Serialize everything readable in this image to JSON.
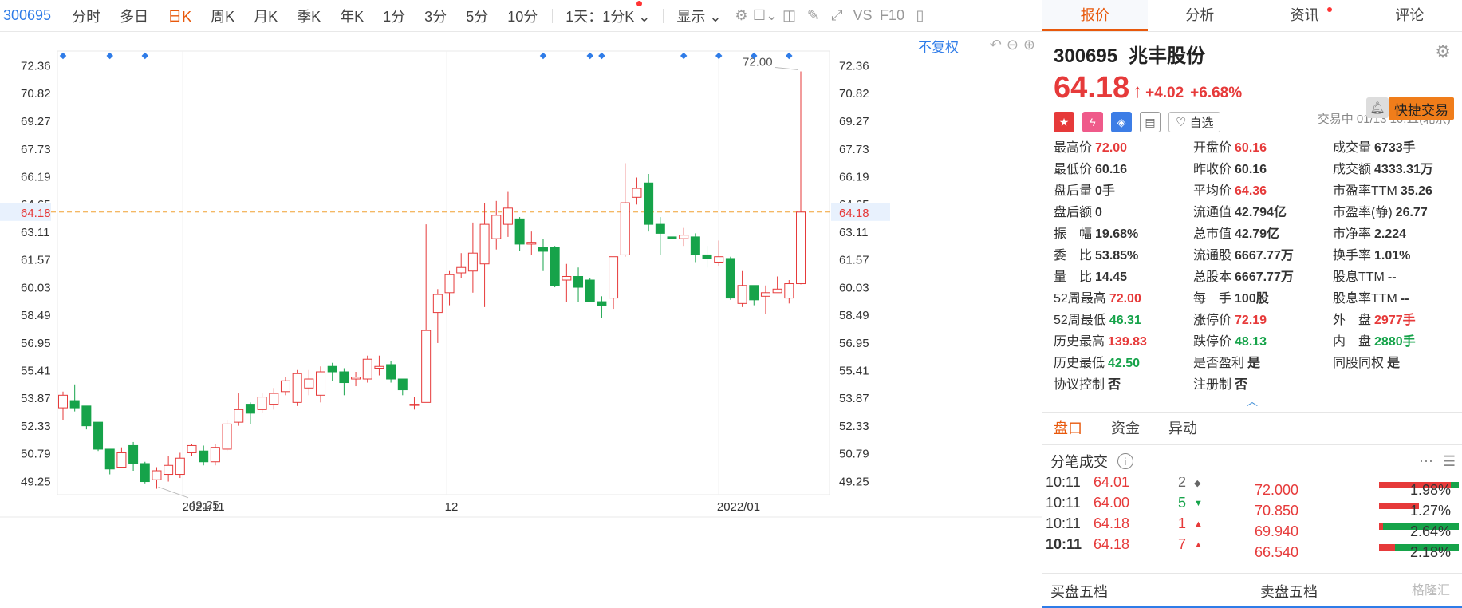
{
  "toolbar": {
    "code": "300695",
    "periods": [
      "分时",
      "多日",
      "日K",
      "周K",
      "月K",
      "季K",
      "年K",
      "1分",
      "3分",
      "5分",
      "10分"
    ],
    "active_period": "日K",
    "multi": "1天：1分K",
    "display": "显示",
    "vs": "VS",
    "f10": "F10"
  },
  "chart": {
    "fq_label": "不复权",
    "y_ticks": [
      "72.36",
      "70.82",
      "69.27",
      "67.73",
      "66.19",
      "64.65",
      "63.11",
      "61.57",
      "60.03",
      "58.49",
      "56.95",
      "55.41",
      "53.87",
      "52.33",
      "50.79",
      "49.25"
    ],
    "current_price_label": "64.18",
    "x_labels": [
      "2021/11",
      "12",
      "2022/01"
    ],
    "high_label": "72.00",
    "low_label": "49.25"
  },
  "chart_data": {
    "type": "candlestick",
    "y_range": [
      48.47,
      73.13
    ],
    "current_price": 64.18,
    "candles": [
      {
        "o": 53.3,
        "c": 54.0,
        "h": 54.2,
        "l": 52.6
      },
      {
        "o": 53.7,
        "c": 53.3,
        "h": 54.6,
        "l": 53.1
      },
      {
        "o": 53.4,
        "c": 52.3,
        "h": 53.4,
        "l": 52.1
      },
      {
        "o": 52.5,
        "c": 51.0,
        "h": 52.5,
        "l": 50.9
      },
      {
        "o": 51.0,
        "c": 49.9,
        "h": 51.0,
        "l": 49.6
      },
      {
        "o": 50.0,
        "c": 50.8,
        "h": 51.1,
        "l": 50.0
      },
      {
        "o": 51.2,
        "c": 50.2,
        "h": 51.4,
        "l": 49.8
      },
      {
        "o": 50.2,
        "c": 49.2,
        "h": 50.3,
        "l": 49.1
      },
      {
        "o": 49.3,
        "c": 49.8,
        "h": 50.0,
        "l": 48.8
      },
      {
        "o": 49.6,
        "c": 50.1,
        "h": 50.6,
        "l": 49.2
      },
      {
        "o": 49.6,
        "c": 50.5,
        "h": 50.8,
        "l": 49.4
      },
      {
        "o": 50.8,
        "c": 51.2,
        "h": 51.3,
        "l": 50.6
      },
      {
        "o": 50.9,
        "c": 50.3,
        "h": 51.2,
        "l": 50.1
      },
      {
        "o": 50.3,
        "c": 51.1,
        "h": 51.3,
        "l": 50.1
      },
      {
        "o": 51.0,
        "c": 52.4,
        "h": 52.6,
        "l": 50.9
      },
      {
        "o": 52.5,
        "c": 53.2,
        "h": 54.1,
        "l": 52.3
      },
      {
        "o": 53.5,
        "c": 53.0,
        "h": 53.6,
        "l": 52.4
      },
      {
        "o": 53.2,
        "c": 53.9,
        "h": 54.1,
        "l": 53.0
      },
      {
        "o": 53.5,
        "c": 54.1,
        "h": 54.4,
        "l": 53.2
      },
      {
        "o": 54.2,
        "c": 54.8,
        "h": 55.0,
        "l": 54.0
      },
      {
        "o": 53.6,
        "c": 55.2,
        "h": 55.4,
        "l": 53.4
      },
      {
        "o": 54.4,
        "c": 54.9,
        "h": 55.4,
        "l": 54.0
      },
      {
        "o": 54.0,
        "c": 55.3,
        "h": 55.6,
        "l": 53.6
      },
      {
        "o": 55.6,
        "c": 55.3,
        "h": 55.8,
        "l": 54.8
      },
      {
        "o": 55.3,
        "c": 54.7,
        "h": 55.5,
        "l": 54.0
      },
      {
        "o": 54.9,
        "c": 55.0,
        "h": 55.3,
        "l": 54.5
      },
      {
        "o": 54.9,
        "c": 56.0,
        "h": 56.2,
        "l": 54.7
      },
      {
        "o": 55.5,
        "c": 55.6,
        "h": 56.2,
        "l": 55.1
      },
      {
        "o": 55.7,
        "c": 54.9,
        "h": 55.9,
        "l": 54.7
      },
      {
        "o": 54.9,
        "c": 54.3,
        "h": 54.9,
        "l": 54.0
      },
      {
        "o": 53.5,
        "c": 53.5,
        "h": 53.9,
        "l": 53.2
      },
      {
        "o": 53.6,
        "c": 57.6,
        "h": 63.5,
        "l": 53.6
      },
      {
        "o": 58.6,
        "c": 59.6,
        "h": 59.9,
        "l": 56.9
      },
      {
        "o": 59.7,
        "c": 60.7,
        "h": 60.9,
        "l": 59.0
      },
      {
        "o": 60.8,
        "c": 61.1,
        "h": 61.9,
        "l": 60.5
      },
      {
        "o": 60.9,
        "c": 61.9,
        "h": 63.6,
        "l": 59.7
      },
      {
        "o": 61.3,
        "c": 63.5,
        "h": 64.7,
        "l": 58.9
      },
      {
        "o": 62.7,
        "c": 64.0,
        "h": 64.8,
        "l": 62.1
      },
      {
        "o": 63.5,
        "c": 64.4,
        "h": 65.3,
        "l": 62.8
      },
      {
        "o": 63.8,
        "c": 62.4,
        "h": 63.9,
        "l": 62.0
      },
      {
        "o": 62.4,
        "c": 62.5,
        "h": 63.1,
        "l": 61.8
      },
      {
        "o": 62.2,
        "c": 62.0,
        "h": 62.7,
        "l": 60.9
      },
      {
        "o": 62.2,
        "c": 60.1,
        "h": 62.3,
        "l": 60.0
      },
      {
        "o": 60.4,
        "c": 60.6,
        "h": 61.3,
        "l": 59.2
      },
      {
        "o": 60.6,
        "c": 60.0,
        "h": 61.1,
        "l": 59.2
      },
      {
        "o": 60.4,
        "c": 59.2,
        "h": 60.5,
        "l": 59.2
      },
      {
        "o": 59.2,
        "c": 59.0,
        "h": 59.5,
        "l": 58.3
      },
      {
        "o": 59.4,
        "c": 61.7,
        "h": 61.7,
        "l": 58.8
      },
      {
        "o": 61.8,
        "c": 64.7,
        "h": 66.9,
        "l": 61.7
      },
      {
        "o": 65.0,
        "c": 65.5,
        "h": 66.1,
        "l": 64.6
      },
      {
        "o": 65.8,
        "c": 63.5,
        "h": 66.3,
        "l": 63.1
      },
      {
        "o": 63.5,
        "c": 63.0,
        "h": 63.9,
        "l": 61.8
      },
      {
        "o": 62.8,
        "c": 62.7,
        "h": 63.2,
        "l": 61.9
      },
      {
        "o": 62.7,
        "c": 62.9,
        "h": 63.3,
        "l": 62.3
      },
      {
        "o": 62.8,
        "c": 61.8,
        "h": 63.0,
        "l": 61.4
      },
      {
        "o": 61.8,
        "c": 61.6,
        "h": 62.3,
        "l": 61.1
      },
      {
        "o": 61.4,
        "c": 61.7,
        "h": 62.6,
        "l": 61.2
      },
      {
        "o": 61.6,
        "c": 59.4,
        "h": 61.7,
        "l": 59.3
      },
      {
        "o": 59.1,
        "c": 60.1,
        "h": 60.9,
        "l": 58.9
      },
      {
        "o": 60.1,
        "c": 59.3,
        "h": 60.1,
        "l": 59.0
      },
      {
        "o": 59.5,
        "c": 59.7,
        "h": 60.1,
        "l": 58.5
      },
      {
        "o": 59.7,
        "c": 59.9,
        "h": 60.6,
        "l": 59.7
      },
      {
        "o": 59.4,
        "c": 60.2,
        "h": 60.4,
        "l": 59.1
      },
      {
        "o": 60.2,
        "c": 64.18,
        "h": 72.0,
        "l": 60.16
      }
    ],
    "markers_count": 10
  },
  "panel": {
    "tabs": [
      "报价",
      "分析",
      "资讯",
      "评论"
    ],
    "active_tab": "报价",
    "code": "300695",
    "name": "兆丰股份",
    "price": "64.18",
    "change": "+4.02",
    "change_pct": "+6.68%",
    "status": "交易中 01/13 10:11(北京)",
    "watch_label": "自选",
    "quick_trade": "快捷交易",
    "quotes": [
      [
        {
          "k": "最高价",
          "v": "72.00",
          "c": "red"
        },
        {
          "k": "开盘价",
          "v": "60.16",
          "c": "red"
        },
        {
          "k": "成交量",
          "v": "6733手",
          "c": ""
        }
      ],
      [
        {
          "k": "最低价",
          "v": "60.16",
          "c": ""
        },
        {
          "k": "昨收价",
          "v": "60.16",
          "c": ""
        },
        {
          "k": "成交额",
          "v": "4333.31万",
          "c": ""
        }
      ],
      [
        {
          "k": "盘后量",
          "v": "0手",
          "c": ""
        },
        {
          "k": "平均价",
          "v": "64.36",
          "c": "red"
        },
        {
          "k": "市盈率TTM",
          "v": "35.26",
          "c": ""
        }
      ],
      [
        {
          "k": "盘后额",
          "v": "0",
          "c": ""
        },
        {
          "k": "流通值",
          "v": "42.794亿",
          "c": ""
        },
        {
          "k": "市盈率(静)",
          "v": "26.77",
          "c": ""
        }
      ],
      [
        {
          "k": "振　幅",
          "v": "19.68%",
          "c": ""
        },
        {
          "k": "总市值",
          "v": "42.79亿",
          "c": ""
        },
        {
          "k": "市净率",
          "v": "2.224",
          "c": ""
        }
      ],
      [
        {
          "k": "委　比",
          "v": "53.85%",
          "c": ""
        },
        {
          "k": "流通股",
          "v": "6667.77万",
          "c": ""
        },
        {
          "k": "换手率",
          "v": "1.01%",
          "c": ""
        }
      ],
      [
        {
          "k": "量　比",
          "v": "14.45",
          "c": ""
        },
        {
          "k": "总股本",
          "v": "6667.77万",
          "c": ""
        },
        {
          "k": "股息TTM",
          "v": "--",
          "c": ""
        }
      ],
      [
        {
          "k": "52周最高",
          "v": "72.00",
          "c": "red"
        },
        {
          "k": "每　手",
          "v": "100股",
          "c": ""
        },
        {
          "k": "股息率TTM",
          "v": "--",
          "c": ""
        }
      ],
      [
        {
          "k": "52周最低",
          "v": "46.31",
          "c": "green"
        },
        {
          "k": "涨停价",
          "v": "72.19",
          "c": "red"
        },
        {
          "k": "外　盘",
          "v": "2977手",
          "c": "red"
        }
      ],
      [
        {
          "k": "历史最高",
          "v": "139.83",
          "c": "red"
        },
        {
          "k": "跌停价",
          "v": "48.13",
          "c": "green"
        },
        {
          "k": "内　盘",
          "v": "2880手",
          "c": "green"
        }
      ],
      [
        {
          "k": "历史最低",
          "v": "42.50",
          "c": "green"
        },
        {
          "k": "是否盈利",
          "v": "是",
          "c": ""
        },
        {
          "k": "同股同权",
          "v": "是",
          "c": ""
        }
      ],
      [
        {
          "k": "协议控制",
          "v": "否",
          "c": ""
        },
        {
          "k": "注册制",
          "v": "否",
          "c": ""
        },
        {
          "k": "",
          "v": "",
          "c": ""
        }
      ]
    ],
    "subtabs": [
      "盘口",
      "资金",
      "异动"
    ],
    "active_subtab": "盘口",
    "ticks_title": "分笔成交",
    "ticks": [
      {
        "time": "10:11",
        "price": "64.01",
        "vol": "2",
        "dir": "neutral"
      },
      {
        "time": "10:11",
        "price": "64.00",
        "vol": "5",
        "dir": "down"
      },
      {
        "time": "10:11",
        "price": "64.18",
        "vol": "1",
        "dir": "up"
      },
      {
        "time": "10:11",
        "price": "64.18",
        "vol": "7",
        "dir": "up"
      }
    ],
    "depth": [
      {
        "price": "72.000",
        "pct": "1.98%",
        "red": 0.9,
        "green": 0.1
      },
      {
        "price": "70.850",
        "pct": "1.27%",
        "red": 0.5,
        "green": 0
      },
      {
        "price": "69.940",
        "pct": "2.64%",
        "red": 0.05,
        "green": 0.95
      },
      {
        "price": "66.540",
        "pct": "2.18%",
        "red": 0.2,
        "green": 0.8
      }
    ],
    "book_tabs": [
      "买盘五档",
      "卖盘五档"
    ],
    "watermark": "格隆汇"
  },
  "colors": {
    "up": "#e63a3a",
    "down": "#16a34a",
    "accent": "#e8590c",
    "link": "#2f7ce8"
  }
}
